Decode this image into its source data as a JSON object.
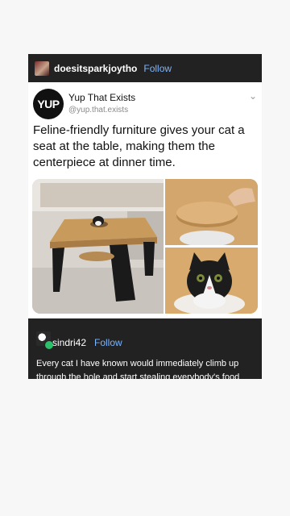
{
  "post": {
    "username": "doesitsparkjoytho",
    "follow_label": "Follow"
  },
  "card": {
    "account_name": "Yup That Exists",
    "account_handle": "@yup.that.exists",
    "logo_text": "YUP",
    "tweet_text": "Feline-friendly furniture gives your cat a seat at the table, making them the centerpiece at dinner time."
  },
  "comment": {
    "username": "sindri42",
    "follow_label": "Follow",
    "text": "Every cat I have known would immediately climb up through the hole and start stealing everybody's food"
  },
  "colors": {
    "header_bg": "#222222",
    "link": "#7bb4ff",
    "badge": "#2bc06a"
  }
}
